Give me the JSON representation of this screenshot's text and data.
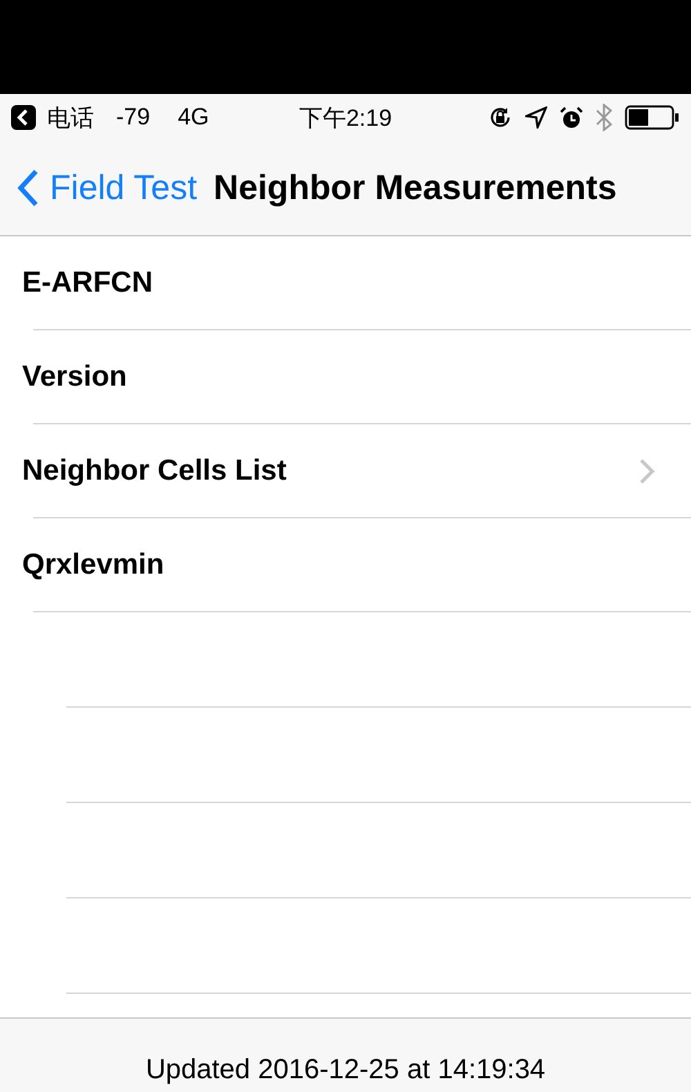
{
  "status_bar": {
    "back_app": "电话",
    "signal": "-79",
    "network": "4G",
    "time": "下午2:19"
  },
  "nav_bar": {
    "back_label": "Field Test",
    "title": "Neighbor Measurements"
  },
  "rows": [
    {
      "label": "E-ARFCN",
      "disclosure": false
    },
    {
      "label": "Version",
      "disclosure": false
    },
    {
      "label": "Neighbor Cells List",
      "disclosure": true
    },
    {
      "label": "Qrxlevmin",
      "disclosure": false
    }
  ],
  "footer": {
    "updated": "Updated 2016-12-25 at 14:19:34"
  }
}
